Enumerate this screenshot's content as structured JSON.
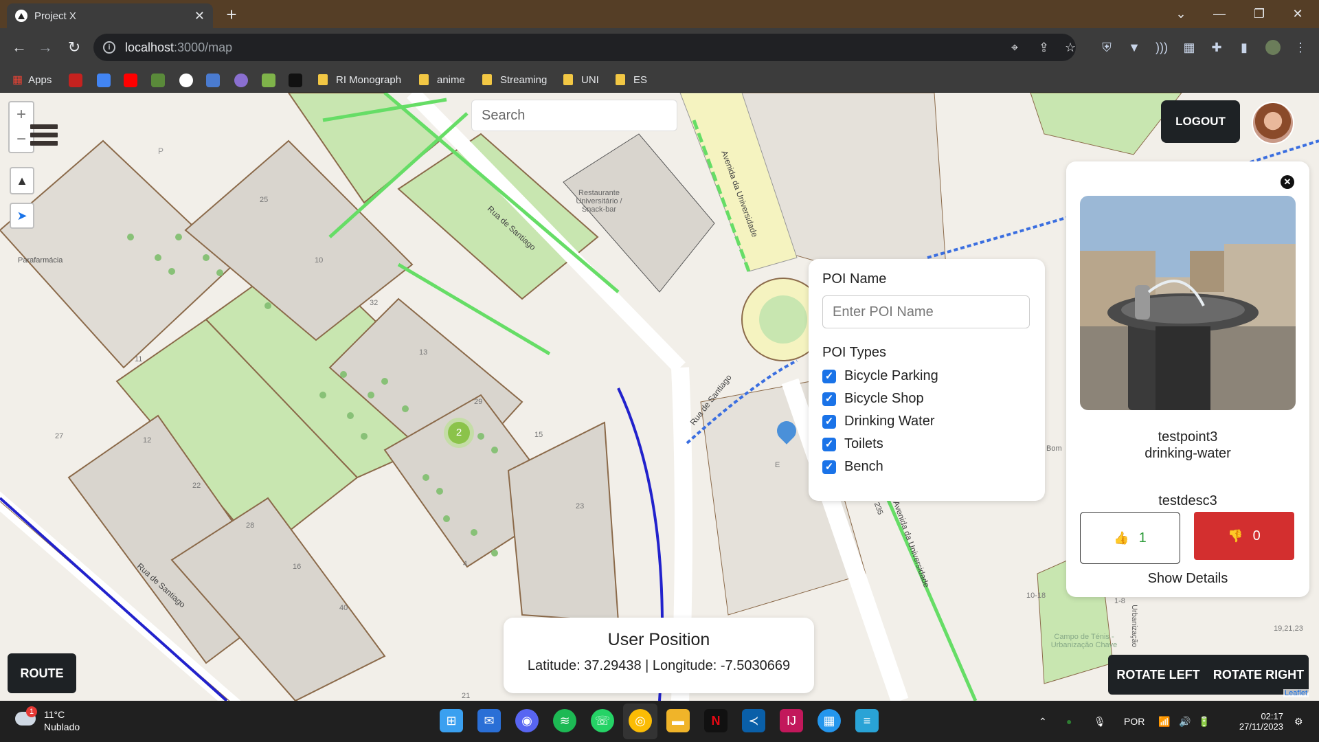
{
  "browser": {
    "tab_title": "Project X",
    "url_host": "localhost",
    "url_path": ":3000/map",
    "bookmarks": [
      "Apps",
      "RI Monograph",
      "anime",
      "Streaming",
      "UNI",
      "ES"
    ]
  },
  "map": {
    "search_placeholder": "Search",
    "cluster_count": "2",
    "zoom_in": "+",
    "zoom_out": "−",
    "street_labels": [
      "Rua de Santiago",
      "Avenida da Universidade",
      "Rua de Santiago",
      "Avenida da Universidade",
      "Rua de Santiago"
    ],
    "place_labels": [
      "Restaurante Universitário / Snack-bar",
      "Parafarmácia",
      "Campo de Ténis - Urbanização Chave",
      "Bom",
      "Urbanização"
    ],
    "house_numbers": [
      "25",
      "10",
      "32",
      "13",
      "11",
      "29",
      "15",
      "27",
      "12",
      "22",
      "28",
      "16",
      "40",
      "23",
      "4",
      "21",
      "E",
      "N 235",
      "10-18",
      "1-8",
      "19,21,23",
      "P"
    ],
    "attribution": "Leaflet"
  },
  "header": {
    "logout_label": "LOGOUT"
  },
  "poi_form": {
    "name_label": "POI Name",
    "name_placeholder": "Enter POI Name",
    "types_label": "POI Types",
    "types": [
      {
        "label": "Bicycle Parking",
        "checked": true
      },
      {
        "label": "Bicycle Shop",
        "checked": true
      },
      {
        "label": "Drinking Water",
        "checked": true
      },
      {
        "label": "Toilets",
        "checked": true
      },
      {
        "label": "Bench",
        "checked": true
      }
    ]
  },
  "details": {
    "name": "testpoint3",
    "type": "drinking-water",
    "description": "testdesc3",
    "likes": "1",
    "dislikes": "0",
    "show_details_label": "Show Details"
  },
  "user_position": {
    "title": "User Position",
    "coords_text": "Latitude: 37.29438 | Longitude: -7.5030669"
  },
  "controls": {
    "route_label": "ROUTE",
    "rotate_left_label": "ROTATE LEFT",
    "rotate_right_label": "ROTATE RIGHT"
  },
  "taskbar": {
    "temperature": "11°C",
    "weather": "Nublado",
    "weather_badge": "1",
    "language": "POR",
    "time": "02:17",
    "date": "27/11/2023"
  },
  "colors": {
    "titlebar": "#553e26",
    "chrome": "#3c3c3c",
    "map_bg": "#f2efe9",
    "park": "#c8e6b0",
    "dislike": "#d32f2f",
    "like_text": "#2e9c3a",
    "checkbox": "#1a73e8",
    "dark_button": "#1e2225"
  }
}
